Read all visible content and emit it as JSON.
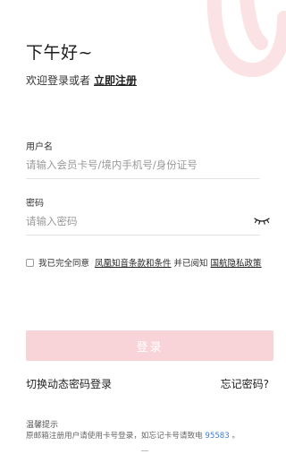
{
  "header": {
    "greeting": "下午好~",
    "subtitle": "欢迎登录或者",
    "register_link": "立即注册"
  },
  "form": {
    "username_label": "用户名",
    "username_placeholder": "请输入会员卡号/境内手机号/身份证号",
    "password_label": "密码",
    "password_placeholder": "请输入密码",
    "password_toggle_icon": "eye-closed-icon"
  },
  "agreement": {
    "prefix": "我已完全同意",
    "terms_link": "凤凰知音条款和条件",
    "middle": "并已阅知",
    "privacy_link": "国航隐私政策",
    "checked": false
  },
  "actions": {
    "login_label": "登录",
    "switch_label": "切换动态密码登录",
    "forgot_label": "忘记密码?"
  },
  "tips": {
    "title": "温馨提示",
    "text_before": "原邮箱注册用户请使用卡号登录，如忘记卡号请致电",
    "phone": "95583",
    "text_after": "。"
  },
  "colors": {
    "accent": "#e6353f",
    "login_button_disabled": "#f8d4d8",
    "link_blue": "#3e7fd6"
  }
}
